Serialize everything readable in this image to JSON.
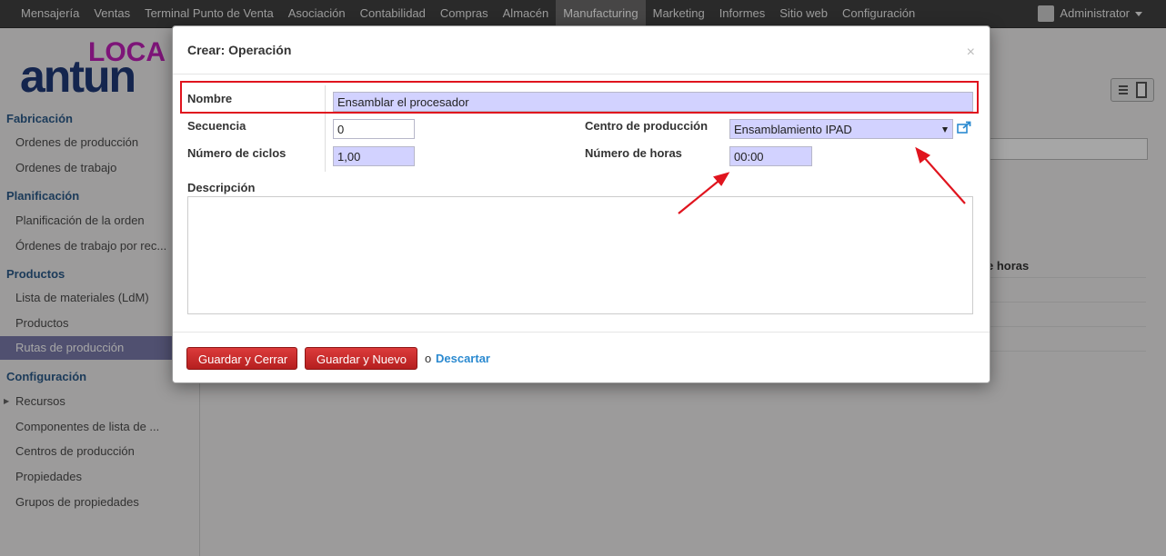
{
  "topnav": {
    "items": [
      "Mensajería",
      "Ventas",
      "Terminal Punto de Venta",
      "Asociación",
      "Contabilidad",
      "Compras",
      "Almacén",
      "Manufacturing",
      "Marketing",
      "Informes",
      "Sitio web",
      "Configuración"
    ],
    "active_item": "Manufacturing",
    "user": "Administrator"
  },
  "logo": {
    "top_text": "LOCA",
    "main_text": "antun"
  },
  "sidebar": {
    "sections": [
      {
        "title": "Fabricación",
        "items": [
          "Ordenes de producción",
          "Ordenes de trabajo"
        ]
      },
      {
        "title": "Planificación",
        "items": [
          "Planificación de la orden",
          "Órdenes de trabajo por rec..."
        ]
      },
      {
        "title": "Productos",
        "items": [
          "Lista de materiales (LdM)",
          "Productos",
          "Rutas de producción"
        ]
      },
      {
        "title": "Configuración",
        "items": [
          "Recursos",
          "Componentes de lista de ...",
          "Centros de producción",
          "Propiedades",
          "Grupos de propiedades"
        ]
      }
    ],
    "active_item": "Rutas de producción"
  },
  "background": {
    "column_header": "e horas"
  },
  "modal": {
    "title": "Crear: Operación",
    "close": "×",
    "fields": {
      "nombre": {
        "label": "Nombre",
        "value": "Ensamblar el procesador"
      },
      "secuencia": {
        "label": "Secuencia",
        "value": "0"
      },
      "ciclos": {
        "label": "Número de ciclos",
        "value": "1,00"
      },
      "centro": {
        "label": "Centro de producción",
        "value": "Ensamblamiento IPAD"
      },
      "horas": {
        "label": "Número de horas",
        "value": "00:00"
      },
      "descripcion": {
        "label": "Descripción",
        "value": ""
      }
    },
    "buttons": {
      "save_close": "Guardar y Cerrar",
      "save_new": "Guardar y Nuevo",
      "or": "o",
      "discard": "Descartar"
    }
  },
  "colors": {
    "nav_bg": "#414141",
    "required_field": "#d2d2ff",
    "primary_button": "#c92a2a",
    "highlight": "#e0141e",
    "link": "#2b8ad0",
    "sidebar_active": "#7c7bad"
  }
}
